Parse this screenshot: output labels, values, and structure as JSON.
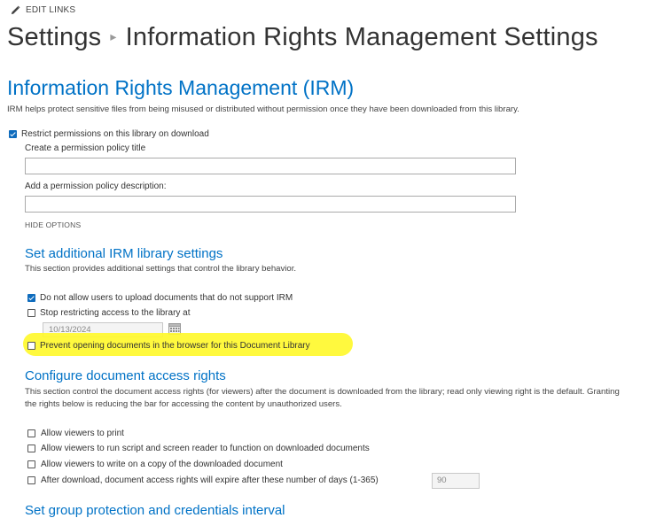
{
  "header": {
    "edit_links": "EDIT LINKS",
    "breadcrumb_root": "Settings",
    "breadcrumb_separator": "▸",
    "page_title": "Information Rights Management Settings"
  },
  "irm": {
    "title": "Information Rights Management (IRM)",
    "description": "IRM helps protect sensitive files from being misused or distributed without permission once they have been downloaded from this library.",
    "restrict_label": "Restrict permissions on this library on download",
    "restrict_checked": true,
    "policy_title_label": "Create a permission policy title",
    "policy_title_value": "",
    "policy_desc_label": "Add a permission policy description:",
    "policy_desc_value": "",
    "hide_options": "HIDE OPTIONS"
  },
  "library_settings": {
    "title": "Set additional IRM library settings",
    "description": "This section provides additional settings that control the library behavior.",
    "items": [
      {
        "label": "Do not allow users to upload documents that do not support IRM",
        "checked": true
      },
      {
        "label": "Stop restricting access to the library at",
        "checked": false
      },
      {
        "label": "Prevent opening documents in the browser for this Document Library",
        "checked": false
      }
    ],
    "stop_date": "10/13/2024"
  },
  "access_rights": {
    "title": "Configure document access rights",
    "description": "This section control the document access rights (for viewers) after the document is downloaded from the library; read only viewing right is the default. Granting the rights below is reducing the bar for accessing the content by unauthorized users.",
    "items": [
      {
        "label": "Allow viewers to print",
        "checked": false
      },
      {
        "label": "Allow viewers to run script and screen reader to function on downloaded documents",
        "checked": false
      },
      {
        "label": "Allow viewers to write on a copy of the downloaded document",
        "checked": false
      },
      {
        "label": "After download, document access rights will expire after these number of days (1-365)",
        "checked": false
      }
    ],
    "expire_days": "90"
  },
  "next_section": {
    "title": "Set group protection and credentials interval"
  },
  "colors": {
    "accent": "#0072c6",
    "checkbox": "#0f6cbd",
    "highlight": "#fff82e"
  }
}
